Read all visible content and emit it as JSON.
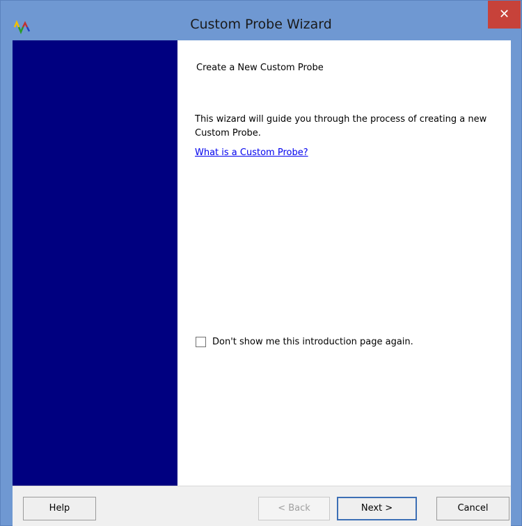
{
  "window": {
    "title": "Custom Probe Wizard",
    "close_symbol": "✕",
    "app_icon": "waveform-probe-icon"
  },
  "content": {
    "heading": "Create a New Custom Probe",
    "description": "This wizard will guide you through the process of creating a new Custom Probe.",
    "link_text": "What is a Custom Probe?",
    "checkbox_label": "Don't show me this introduction page again.",
    "checkbox_checked": false
  },
  "footer": {
    "help_label": "Help",
    "back_label": "< Back",
    "next_label": "Next >",
    "cancel_label": "Cancel"
  },
  "colors": {
    "titlebar": "#6f98d2",
    "side_panel": "#000080",
    "close_button": "#c7423a",
    "link": "#0000ee"
  }
}
